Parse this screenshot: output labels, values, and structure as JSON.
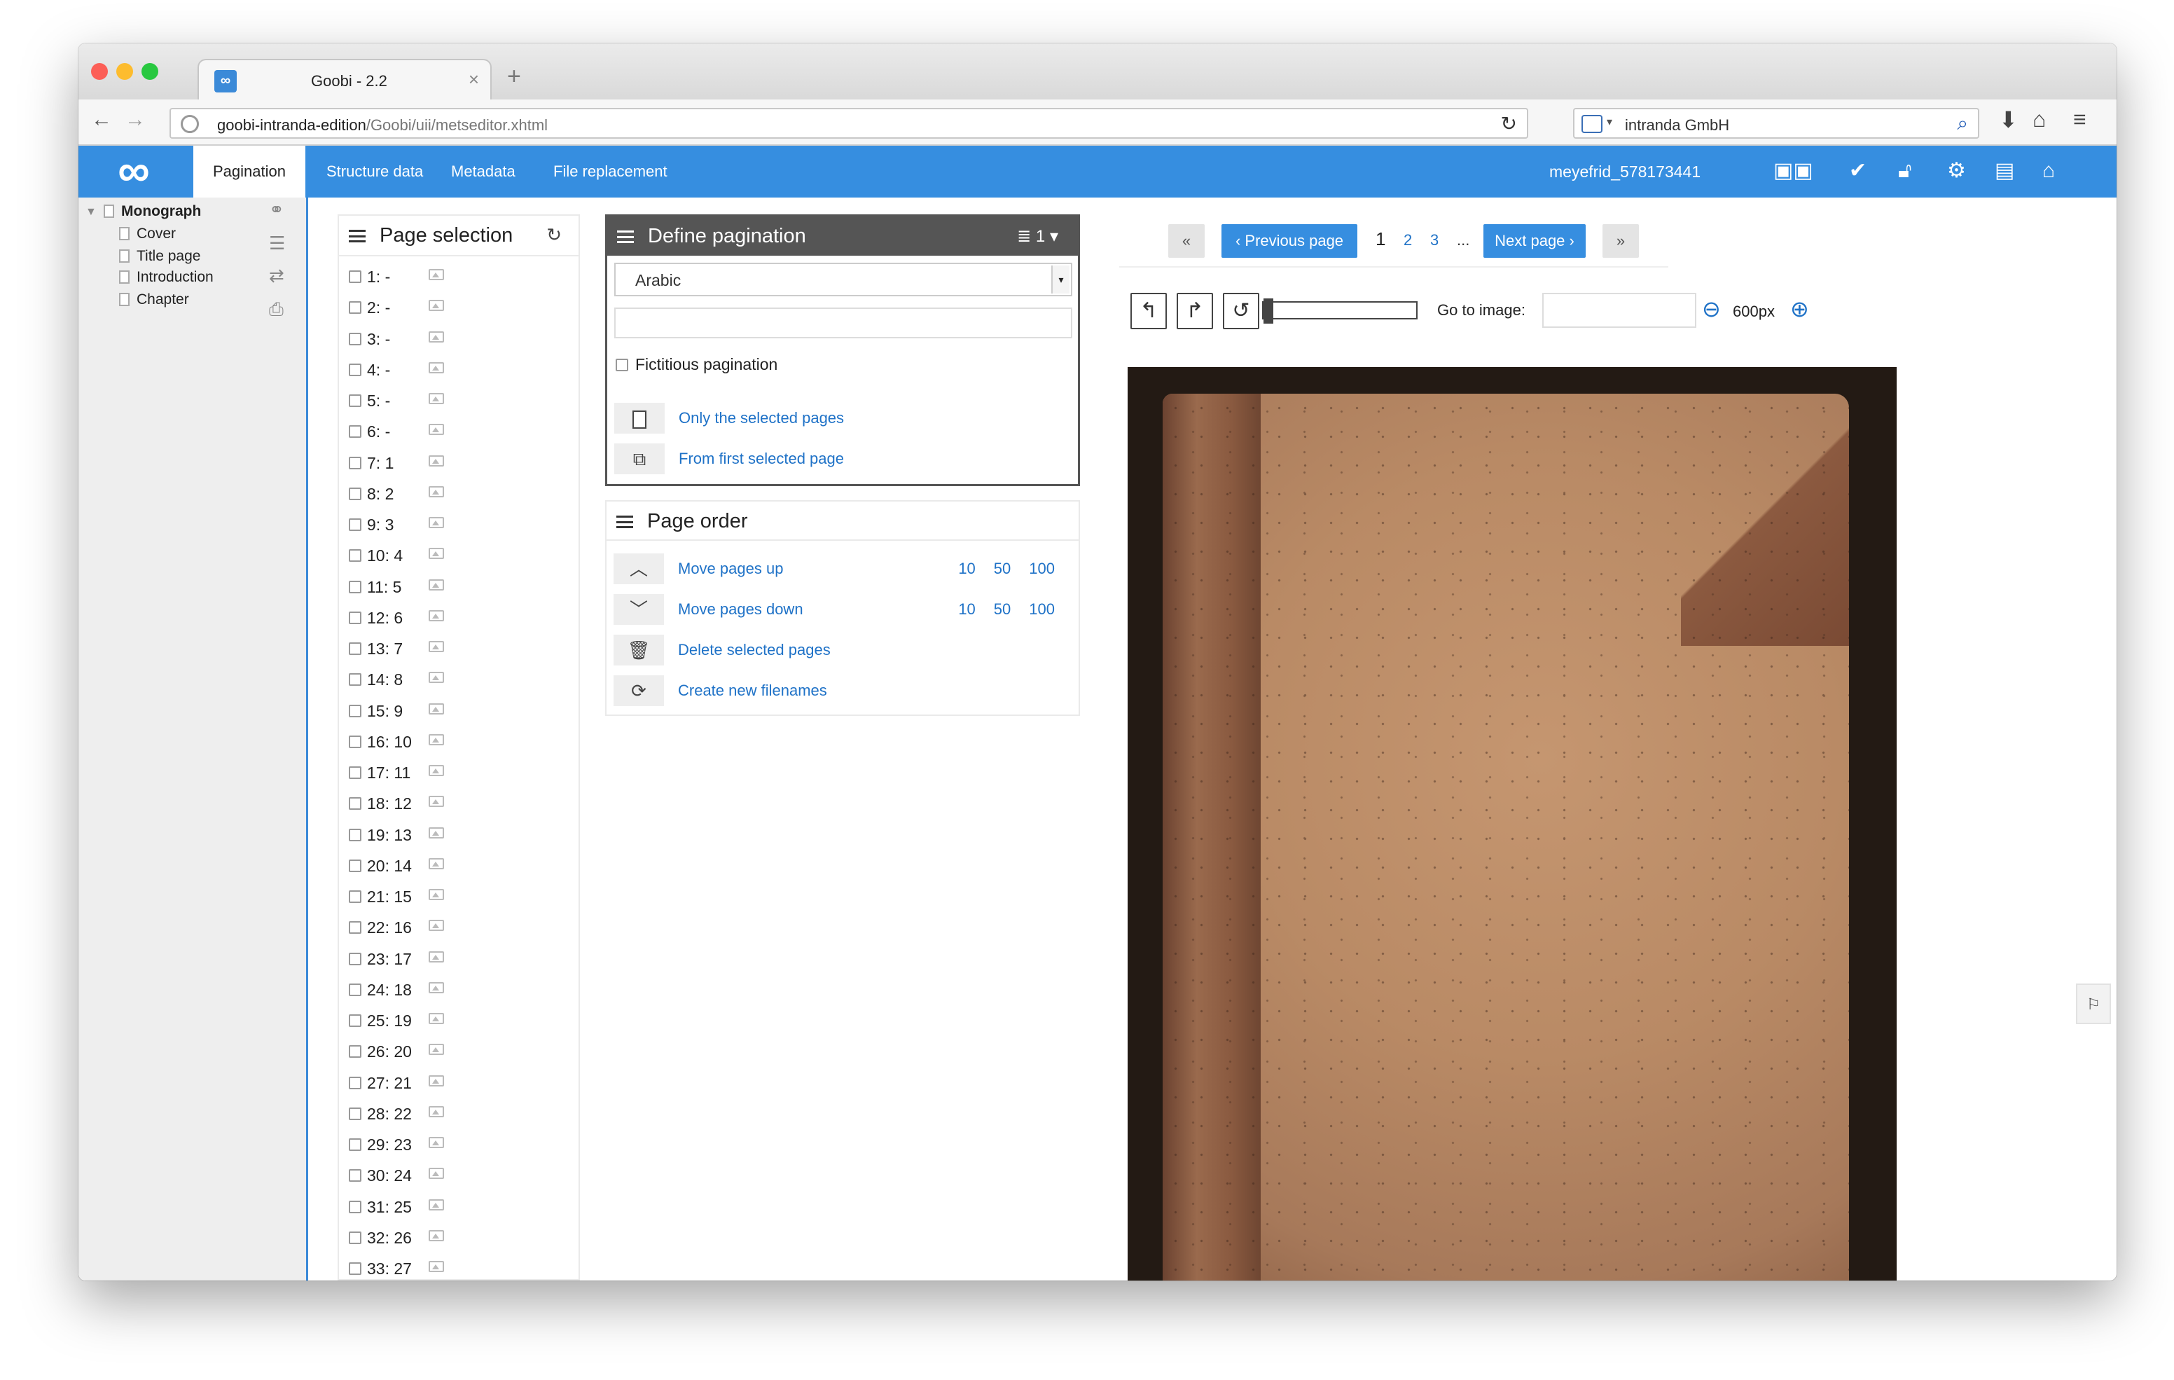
{
  "browser": {
    "tab_title": "Goobi - 2.2",
    "url_host": "goobi-intranda-edition",
    "url_path": "/Goobi/uii/metseditor.xhtml",
    "search_text": "intranda GmbH"
  },
  "appbar": {
    "logo": "∞",
    "tabs": [
      "Pagination",
      "Structure data",
      "Metadata",
      "File replacement"
    ],
    "username": "meyefrid_578173441"
  },
  "tree": {
    "root": "Monograph",
    "children": [
      "Cover",
      "Title page",
      "Introduction",
      "Chapter"
    ]
  },
  "page_selection": {
    "title": "Page selection",
    "pages": [
      "1: -",
      "2: -",
      "3: -",
      "4: -",
      "5: -",
      "6: -",
      "7: 1",
      "8: 2",
      "9: 3",
      "10: 4",
      "11: 5",
      "12: 6",
      "13: 7",
      "14: 8",
      "15: 9",
      "16: 10",
      "17: 11",
      "18: 12",
      "19: 13",
      "20: 14",
      "21: 15",
      "22: 16",
      "23: 17",
      "24: 18",
      "25: 19",
      "26: 20",
      "27: 21",
      "28: 22",
      "29: 23",
      "30: 24",
      "31: 25",
      "32: 26",
      "33: 27"
    ]
  },
  "define_pagination": {
    "title": "Define pagination",
    "mode_label": "1",
    "type_value": "Arabic",
    "fictitious_label": "Fictitious pagination",
    "only_selected": "Only the selected pages",
    "from_first": "From first selected page"
  },
  "page_order": {
    "title": "Page order",
    "move_up": "Move pages up",
    "move_down": "Move pages down",
    "delete": "Delete selected pages",
    "new_filenames": "Create new filenames",
    "steps": [
      "10",
      "50",
      "100"
    ]
  },
  "viewer": {
    "first": "«",
    "prev": "‹ Previous page",
    "page_current": "1",
    "page_2": "2",
    "page_3": "3",
    "ellipsis": "...",
    "next": "Next page ›",
    "last": "»",
    "goto_label": "Go to image:",
    "zoom": "600px"
  },
  "colors": {
    "accent": "#368ee0",
    "link": "#1f72c7",
    "panel_dark": "#555555"
  }
}
